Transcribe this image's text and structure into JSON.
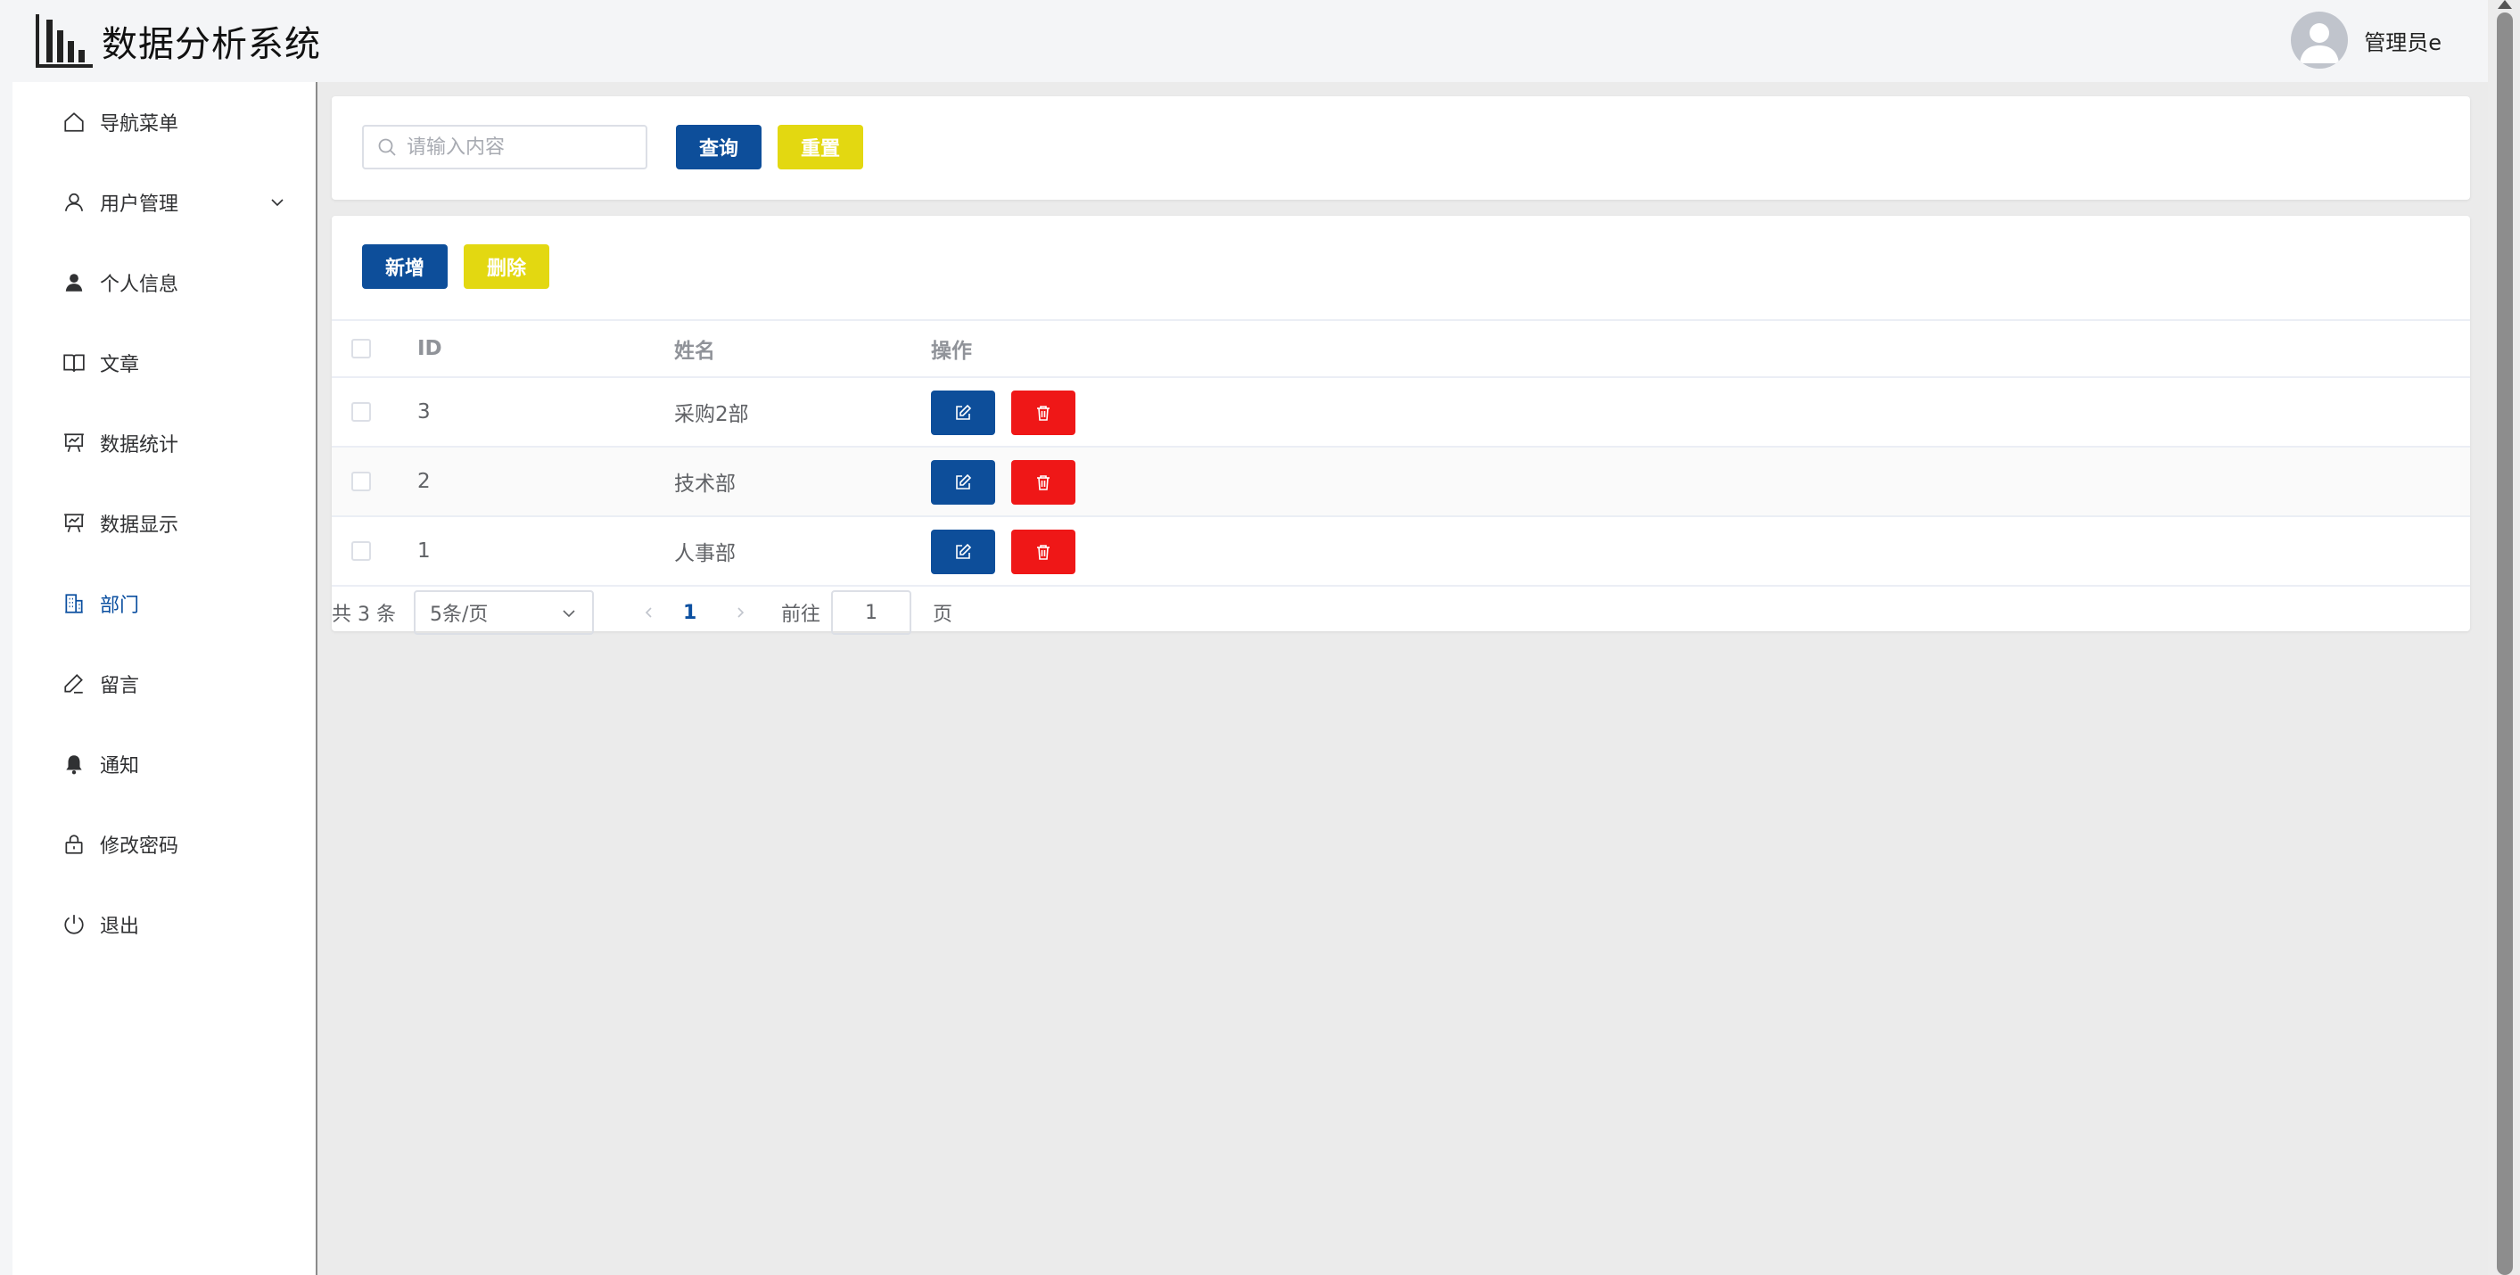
{
  "app": {
    "title": "数据分析系统"
  },
  "user": {
    "name": "管理员e"
  },
  "sidebar": {
    "items": [
      {
        "label": "导航菜单",
        "icon": "home-icon"
      },
      {
        "label": "用户管理",
        "icon": "user-icon",
        "expandable": true
      },
      {
        "label": "个人信息",
        "icon": "user-filled-icon"
      },
      {
        "label": "文章",
        "icon": "book-icon"
      },
      {
        "label": "数据统计",
        "icon": "data-board-icon"
      },
      {
        "label": "数据显示",
        "icon": "data-board-icon"
      },
      {
        "label": "部门",
        "icon": "office-building-icon",
        "active": true
      },
      {
        "label": "留言",
        "icon": "edit-pen-icon"
      },
      {
        "label": "通知",
        "icon": "bell-filled-icon"
      },
      {
        "label": "修改密码",
        "icon": "lock-icon"
      },
      {
        "label": "退出",
        "icon": "power-icon"
      }
    ],
    "active_color": "#0b4fa0"
  },
  "search": {
    "placeholder": "请输入内容",
    "value": "",
    "query_label": "查询",
    "reset_label": "重置"
  },
  "toolbar": {
    "add_label": "新增",
    "delete_label": "删除"
  },
  "table": {
    "columns": [
      "ID",
      "姓名",
      "操作"
    ],
    "rows": [
      {
        "id": "3",
        "name": "采购2部"
      },
      {
        "id": "2",
        "name": "技术部"
      },
      {
        "id": "1",
        "name": "人事部"
      }
    ]
  },
  "pagination": {
    "total_text": "共 3 条",
    "page_size": "5条/页",
    "current_page": "1",
    "goto_label": "前往",
    "goto_value": "1",
    "unit": "页"
  },
  "colors": {
    "primary": "#0d4e9a",
    "warning": "#e3d811",
    "danger": "#ef1717"
  }
}
